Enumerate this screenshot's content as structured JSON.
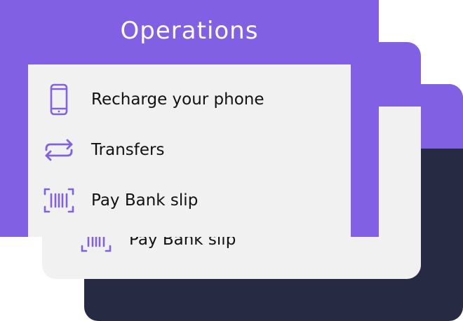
{
  "header": {
    "title": "Operations"
  },
  "menu": {
    "items": [
      {
        "label": "Recharge your phone",
        "icon": "phone-icon"
      },
      {
        "label": "Transfers",
        "icon": "transfer-arrows-icon"
      },
      {
        "label": "Pay Bank slip",
        "icon": "barcode-icon"
      }
    ]
  },
  "middle_card": {
    "partial_item_label": "Pay Bank slip",
    "icon": "barcode-icon"
  },
  "colors": {
    "accent": "#8260e3",
    "card_bg": "#f1f1f1",
    "dark": "#262a42"
  }
}
